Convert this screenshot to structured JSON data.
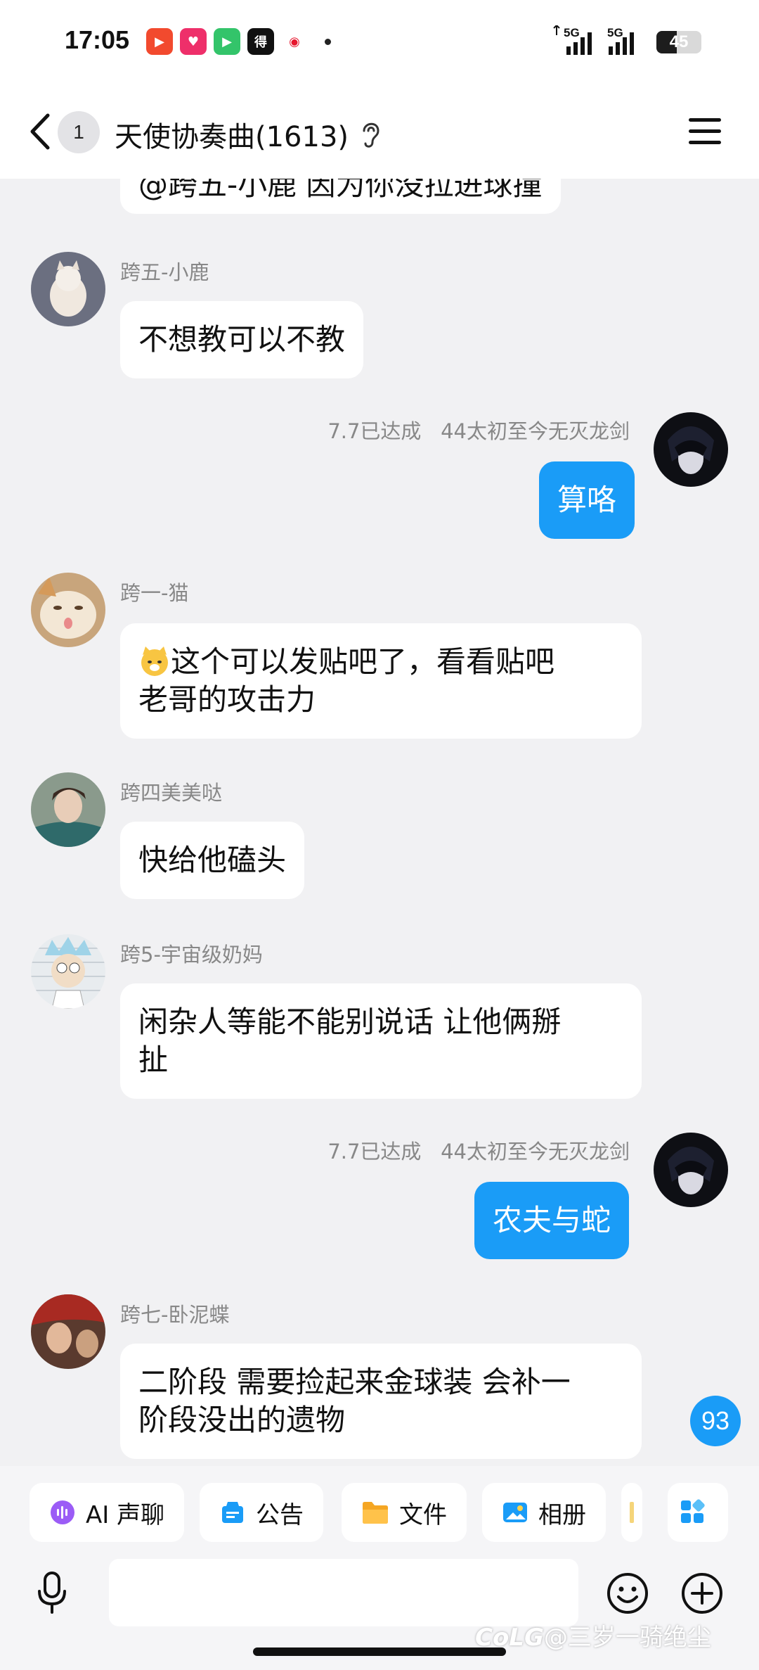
{
  "status_bar": {
    "time": "17:05",
    "battery_level": "45",
    "network_1": "5G",
    "network_2": "5G",
    "icons": [
      "video-app-icon",
      "shopping-app-icon",
      "player-app-icon",
      "news-app-icon",
      "weibo-icon"
    ]
  },
  "header": {
    "unread_count": "1",
    "title": "天使协奏曲(1613)"
  },
  "messages": [
    {
      "type": "partial",
      "text": "@跨五-小鹿 因为你没拉进球撞"
    },
    {
      "type": "other",
      "sender": "跨五-小鹿",
      "text": "不想教可以不教"
    },
    {
      "type": "mine",
      "sender_badge": "7.7已达成",
      "sender": "44太初至今无灭龙剑",
      "text": "算咯"
    },
    {
      "type": "other",
      "sender": "跨一-猫",
      "text_line1": "这个可以发贴吧了，看看贴吧",
      "text_line2": "老哥的攻击力"
    },
    {
      "type": "other",
      "sender": "跨四美美哒",
      "text": "快给他磕头"
    },
    {
      "type": "other",
      "sender": "跨5-宇宙级奶妈",
      "text_line1": "闲杂人等能不能别说话 让他俩掰",
      "text_line2": "扯"
    },
    {
      "type": "mine",
      "sender_badge": "7.7已达成",
      "sender": "44太初至今无灭龙剑",
      "text": "农夫与蛇"
    },
    {
      "type": "other",
      "sender": "跨七-卧泥蝶",
      "text_line1": "二阶段 需要捡起来金球装 会补一",
      "text_line2": "阶段没出的遗物"
    }
  ],
  "floating_badge": "93",
  "toolbar": {
    "chips": [
      "AI 声聊",
      "公告",
      "文件",
      "相册"
    ]
  },
  "watermark": "@三岁一骑绝尘",
  "watermark_logo": "CoLG",
  "colors": {
    "accent": "#1a9cf7",
    "background": "#f1f1f3",
    "bubble": "#ffffff"
  }
}
